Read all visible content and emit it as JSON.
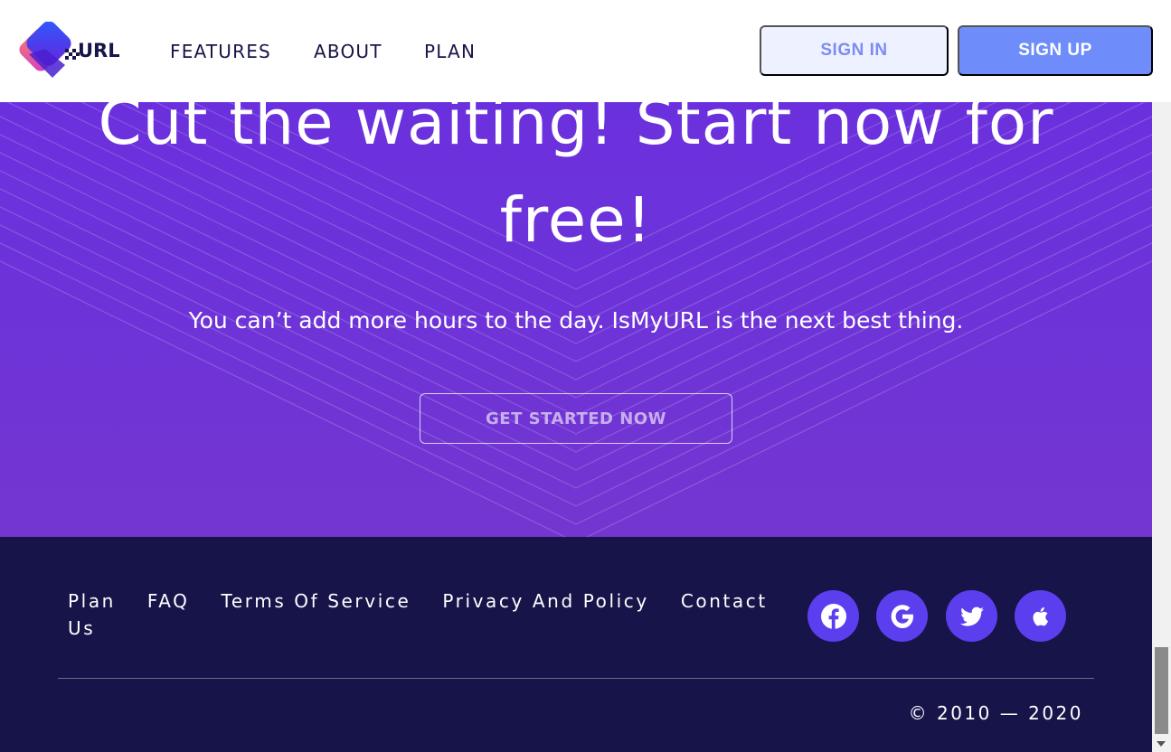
{
  "header": {
    "logo_text": "URL",
    "nav": [
      "FEATURES",
      "ABOUT",
      "PLAN"
    ],
    "sign_in": "SIGN IN",
    "sign_up": "SIGN UP"
  },
  "hero": {
    "title_line1": "Cut the waiting! Start now for",
    "title_line2": "free!",
    "subtitle": "You can’t add more hours to the day. IsMyURL is the next best thing.",
    "cta": "GET STARTED NOW"
  },
  "footer": {
    "links": [
      "Plan",
      "FAQ",
      "Terms Of Service",
      "Privacy And Policy",
      "Contact Us"
    ],
    "social": [
      {
        "icon": "facebook-icon",
        "color": "#5b3fee"
      },
      {
        "icon": "google-icon",
        "color": "#5b3fee"
      },
      {
        "icon": "twitter-icon",
        "color": "#5b3fee"
      },
      {
        "icon": "apple-icon",
        "color": "#5b3fee"
      }
    ],
    "copyright": "© 2010 — 2020"
  },
  "colors": {
    "accent": "#6e8dfb",
    "hero_purple": "#6a2fe0",
    "footer_bg": "#17144a",
    "social_bg": "#5b3fee"
  }
}
